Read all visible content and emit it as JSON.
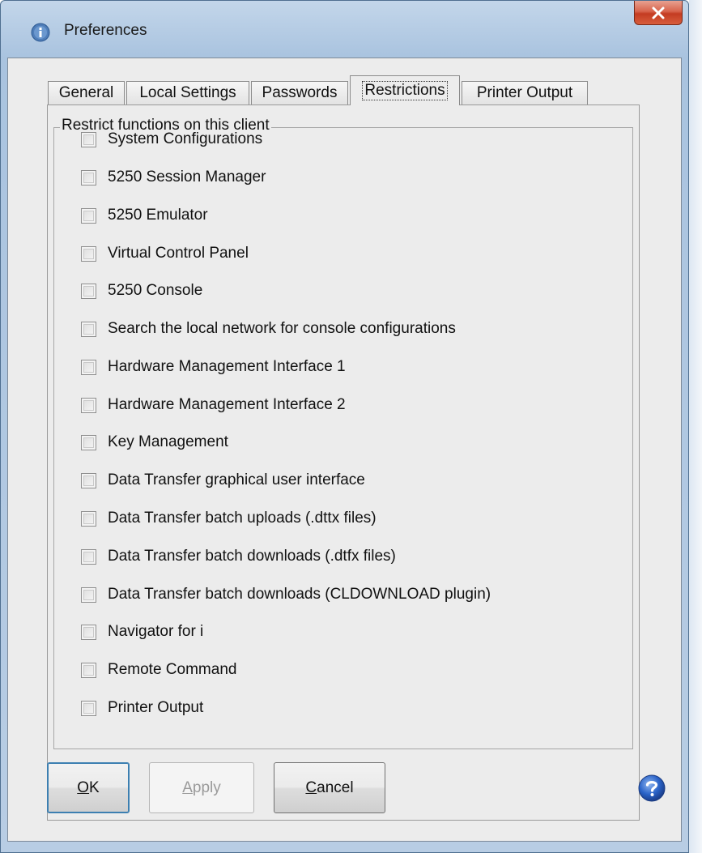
{
  "window": {
    "title": "Preferences",
    "close_label": "X"
  },
  "tabs": [
    {
      "label": "General",
      "active": false
    },
    {
      "label": "Local Settings",
      "active": false
    },
    {
      "label": "Passwords",
      "active": false
    },
    {
      "label": "Restrictions",
      "active": true
    },
    {
      "label": "Printer Output",
      "active": false
    }
  ],
  "group": {
    "title": "Restrict functions on this client"
  },
  "options": [
    {
      "label": "System Configurations",
      "checked": false
    },
    {
      "label": "5250 Session Manager",
      "checked": false
    },
    {
      "label": "5250 Emulator",
      "checked": false
    },
    {
      "label": "Virtual Control Panel",
      "checked": false
    },
    {
      "label": "5250 Console",
      "checked": false
    },
    {
      "label": "Search the local network for console configurations",
      "checked": false
    },
    {
      "label": "Hardware Management Interface 1",
      "checked": false
    },
    {
      "label": "Hardware Management Interface 2",
      "checked": false
    },
    {
      "label": "Key Management",
      "checked": false
    },
    {
      "label": "Data Transfer graphical user interface",
      "checked": false
    },
    {
      "label": "Data Transfer batch uploads (.dttx files)",
      "checked": false
    },
    {
      "label": "Data Transfer batch downloads (.dtfx files)",
      "checked": false
    },
    {
      "label": "Data Transfer batch downloads (CLDOWNLOAD plugin)",
      "checked": false
    },
    {
      "label": "Navigator for i",
      "checked": false
    },
    {
      "label": "Remote Command",
      "checked": false
    },
    {
      "label": "Printer Output",
      "checked": false
    }
  ],
  "buttons": {
    "ok": {
      "mnemonic": "O",
      "rest": "K"
    },
    "apply": {
      "mnemonic": "A",
      "rest": "pply",
      "enabled": false
    },
    "cancel": {
      "mnemonic": "C",
      "rest": "ancel"
    }
  },
  "colors": {
    "titlebar": "#b8cde4",
    "close_button": "#c43c22",
    "dialog_bg": "#ececec",
    "help_icon": "#2a63c8"
  },
  "icons": {
    "title": "info-icon",
    "close": "close-icon",
    "help": "help-icon"
  }
}
